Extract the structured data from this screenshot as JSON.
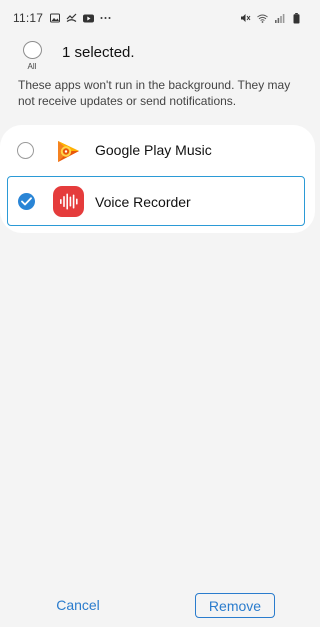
{
  "status_bar": {
    "time": "11:17",
    "left_icons": [
      "gallery-icon",
      "missed-call-icon",
      "youtube-icon",
      "more-dots-icon"
    ],
    "right_icons": [
      "mute-icon",
      "wifi-icon",
      "signal-icon",
      "battery-icon"
    ]
  },
  "header": {
    "all_label": "All",
    "selected_text": "1 selected."
  },
  "info": "These apps won't run in the background. They may not receive updates or send notifications.",
  "apps": [
    {
      "name": "Google Play Music",
      "checked": false,
      "icon": "google-play-music-icon"
    },
    {
      "name": "Voice Recorder",
      "checked": true,
      "icon": "voice-recorder-icon"
    }
  ],
  "buttons": {
    "cancel": "Cancel",
    "remove": "Remove"
  },
  "colors": {
    "accent": "#2a7ccd",
    "check": "#2a85d6",
    "voice_recorder": "#e53c3c"
  }
}
